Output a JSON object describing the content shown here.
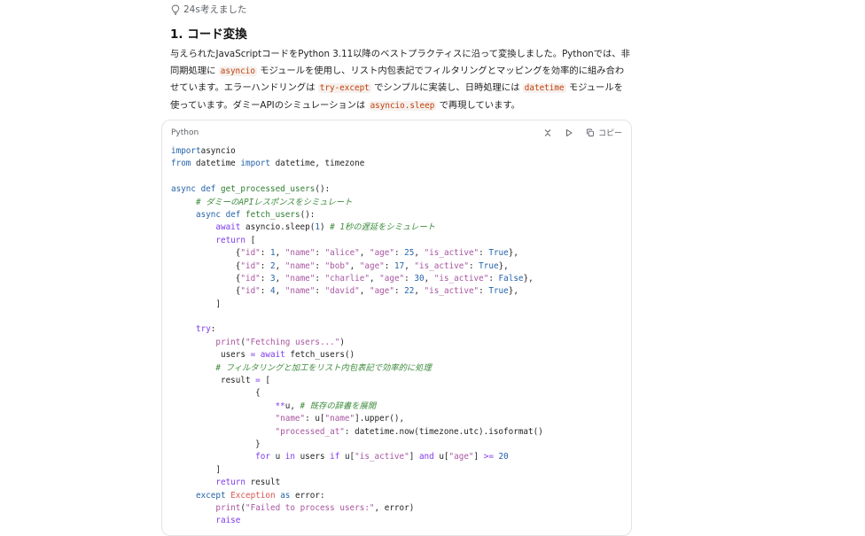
{
  "thought": {
    "label": "24s考えました"
  },
  "heading": "1. コード変換",
  "paragraph": {
    "seg1": "与えられたJavaScriptコードをPython 3.11以降のベストプラクティスに沿って変換しました。Pythonでは、非同期処理に",
    "code1": "asyncio",
    "seg2": "モジュールを使用し、リスト内包表記でフィルタリングとマッピングを効率的に組み合わせています。エラーハンドリングは",
    "code2": "try-except",
    "seg3": "でシンプルに実装し、日時処理には",
    "code3": "datetime",
    "seg4": "モジュールを使っています。ダミーAPIのシミュレーションは",
    "code4": "asyncio.sleep",
    "seg5": "で再現しています。"
  },
  "codeblock": {
    "language": "Python",
    "copy_label": "コピー",
    "lines": [
      [
        [
          "kw2",
          "import"
        ],
        [
          "",
          "asyncio"
        ]
      ],
      [
        [
          "kw2",
          "from"
        ],
        [
          "",
          " datetime "
        ],
        [
          "kw2",
          "import"
        ],
        [
          "",
          " datetime, timezone"
        ]
      ],
      [],
      [
        [
          "kw2",
          "async"
        ],
        [
          "",
          " "
        ],
        [
          "kw2",
          "def"
        ],
        [
          "",
          " "
        ],
        [
          "fn",
          "get_processed_users"
        ],
        [
          "",
          "():"
        ]
      ],
      [
        [
          "",
          " "
        ],
        [
          "com",
          "# ダミーのAPIレスポンスをシミュレート"
        ]
      ],
      [
        [
          "",
          " "
        ],
        [
          "kw2",
          "async"
        ],
        [
          "",
          " "
        ],
        [
          "kw2",
          "def"
        ],
        [
          "",
          " "
        ],
        [
          "fn",
          "fetch_users"
        ],
        [
          "",
          "():"
        ]
      ],
      [
        [
          "",
          " "
        ],
        [
          "kw",
          "await"
        ],
        [
          "",
          " asyncio.sleep("
        ],
        [
          "num",
          "1"
        ],
        [
          "",
          ") "
        ],
        [
          "com",
          "# 1秒の遅延をシミュレート"
        ]
      ],
      [
        [
          "",
          " "
        ],
        [
          "kw",
          "return"
        ],
        [
          "",
          " ["
        ]
      ],
      [
        [
          "",
          "     {"
        ],
        [
          "str",
          "\"id\""
        ],
        [
          "",
          ": "
        ],
        [
          "num",
          "1"
        ],
        [
          "",
          ", "
        ],
        [
          "str",
          "\"name\""
        ],
        [
          "",
          ": "
        ],
        [
          "str",
          "\"alice\""
        ],
        [
          "",
          ", "
        ],
        [
          "str",
          "\"age\""
        ],
        [
          "",
          ": "
        ],
        [
          "num",
          "25"
        ],
        [
          "",
          ", "
        ],
        [
          "str",
          "\"is_active\""
        ],
        [
          "",
          ": "
        ],
        [
          "num",
          "True"
        ],
        [
          "",
          "},"
        ]
      ],
      [
        [
          "",
          "     {"
        ],
        [
          "str",
          "\"id\""
        ],
        [
          "",
          ": "
        ],
        [
          "num",
          "2"
        ],
        [
          "",
          ", "
        ],
        [
          "str",
          "\"name\""
        ],
        [
          "",
          ": "
        ],
        [
          "str",
          "\"bob\""
        ],
        [
          "",
          ", "
        ],
        [
          "str",
          "\"age\""
        ],
        [
          "",
          ": "
        ],
        [
          "num",
          "17"
        ],
        [
          "",
          ", "
        ],
        [
          "str",
          "\"is_active\""
        ],
        [
          "",
          ": "
        ],
        [
          "num",
          "True"
        ],
        [
          "",
          "},"
        ]
      ],
      [
        [
          "",
          "     {"
        ],
        [
          "str",
          "\"id\""
        ],
        [
          "",
          ": "
        ],
        [
          "num",
          "3"
        ],
        [
          "",
          ", "
        ],
        [
          "str",
          "\"name\""
        ],
        [
          "",
          ": "
        ],
        [
          "str",
          "\"charlie\""
        ],
        [
          "",
          ", "
        ],
        [
          "str",
          "\"age\""
        ],
        [
          "",
          ": "
        ],
        [
          "num",
          "30"
        ],
        [
          "",
          ", "
        ],
        [
          "str",
          "\"is_active\""
        ],
        [
          "",
          ": "
        ],
        [
          "num",
          "False"
        ],
        [
          "",
          "},"
        ]
      ],
      [
        [
          "",
          "     {"
        ],
        [
          "str",
          "\"id\""
        ],
        [
          "",
          ": "
        ],
        [
          "num",
          "4"
        ],
        [
          "",
          ", "
        ],
        [
          "str",
          "\"name\""
        ],
        [
          "",
          ": "
        ],
        [
          "str",
          "\"david\""
        ],
        [
          "",
          ", "
        ],
        [
          "str",
          "\"age\""
        ],
        [
          "",
          ": "
        ],
        [
          "num",
          "22"
        ],
        [
          "",
          ", "
        ],
        [
          "str",
          "\"is_active\""
        ],
        [
          "",
          ": "
        ],
        [
          "num",
          "True"
        ],
        [
          "",
          "},"
        ]
      ],
      [
        [
          "",
          " ]"
        ]
      ],
      [],
      [
        [
          "",
          " "
        ],
        [
          "kw",
          "try"
        ],
        [
          "",
          ":"
        ]
      ],
      [
        [
          "",
          " "
        ],
        [
          "bi",
          "print"
        ],
        [
          "",
          "("
        ],
        [
          "str",
          "\"Fetching users...\""
        ],
        [
          "",
          ")"
        ]
      ],
      [
        [
          "",
          "  users "
        ],
        [
          "kw",
          "="
        ],
        [
          "",
          " "
        ],
        [
          "kw",
          "await"
        ],
        [
          "",
          " fetch_users()"
        ]
      ],
      [
        [
          "",
          " "
        ],
        [
          "com",
          "# フィルタリングと加工をリスト内包表記で効率的に処理"
        ]
      ],
      [
        [
          "",
          "  result "
        ],
        [
          "kw",
          "="
        ],
        [
          "",
          " ["
        ]
      ],
      [
        [
          "",
          "     {"
        ]
      ],
      [
        [
          "",
          "         "
        ],
        [
          "kw",
          "**"
        ],
        [
          "",
          "u, "
        ],
        [
          "com",
          "# 既存の辞書を展開"
        ]
      ],
      [
        [
          "",
          "         "
        ],
        [
          "str",
          "\"name\""
        ],
        [
          "",
          ": u["
        ],
        [
          "str",
          "\"name\""
        ],
        [
          "",
          "].upper(),"
        ]
      ],
      [
        [
          "",
          "         "
        ],
        [
          "str",
          "\"processed_at\""
        ],
        [
          "",
          ": datetime.now(timezone.utc).isoformat()"
        ]
      ],
      [
        [
          "",
          "     }"
        ]
      ],
      [
        [
          "",
          "     "
        ],
        [
          "kw",
          "for"
        ],
        [
          "",
          " u "
        ],
        [
          "kw",
          "in"
        ],
        [
          "",
          " users "
        ],
        [
          "kw",
          "if"
        ],
        [
          "",
          " u["
        ],
        [
          "str",
          "\"is_active\""
        ],
        [
          "",
          "] "
        ],
        [
          "kw",
          "and"
        ],
        [
          "",
          " u["
        ],
        [
          "str",
          "\"age\""
        ],
        [
          "",
          "] "
        ],
        [
          "kw",
          ">="
        ],
        [
          "",
          " "
        ],
        [
          "num",
          "20"
        ]
      ],
      [
        [
          "",
          " ]"
        ]
      ],
      [
        [
          "",
          " "
        ],
        [
          "kw",
          "return"
        ],
        [
          "",
          " result"
        ]
      ],
      [
        [
          "",
          " "
        ],
        [
          "kw2",
          "except"
        ],
        [
          "",
          " "
        ],
        [
          "exc",
          "Exception"
        ],
        [
          "",
          " "
        ],
        [
          "kw2",
          "as"
        ],
        [
          "",
          " error:"
        ]
      ],
      [
        [
          "",
          " "
        ],
        [
          "bi",
          "print"
        ],
        [
          "",
          "("
        ],
        [
          "str",
          "\"Failed to process users:\""
        ],
        [
          "",
          ", error)"
        ]
      ],
      [
        [
          "",
          " "
        ],
        [
          "kw",
          "raise"
        ]
      ]
    ],
    "indents": [
      0,
      0,
      0,
      0,
      4,
      4,
      8,
      8,
      8,
      8,
      8,
      8,
      8,
      0,
      4,
      8,
      8,
      8,
      8,
      12,
      12,
      12,
      12,
      12,
      12,
      8,
      8,
      4,
      8,
      8
    ]
  }
}
